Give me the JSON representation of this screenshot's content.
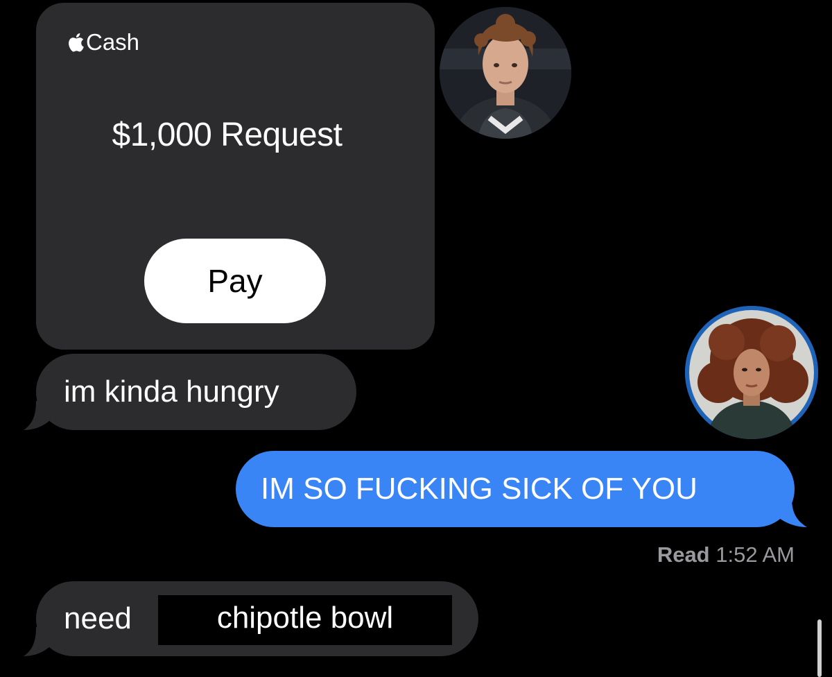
{
  "cash_card": {
    "brand": "Cash",
    "amount_request": "$1,000 Request",
    "pay_label": "Pay"
  },
  "messages": [
    {
      "direction": "received",
      "text": "im kinda hungry"
    },
    {
      "direction": "sent",
      "text": "IM SO FUCKING SICK OF YOU"
    },
    {
      "direction": "received",
      "text": "need",
      "boxed_text": "chipotle bowl"
    }
  ],
  "read_receipt": {
    "label": "Read",
    "time": "1:52 AM"
  },
  "colors": {
    "background": "#000000",
    "received_bubble": "#2c2c2e",
    "sent_bubble": "#3a85f6",
    "receipt_text": "#9a9a9e"
  },
  "icons": [
    "apple-logo-icon"
  ]
}
